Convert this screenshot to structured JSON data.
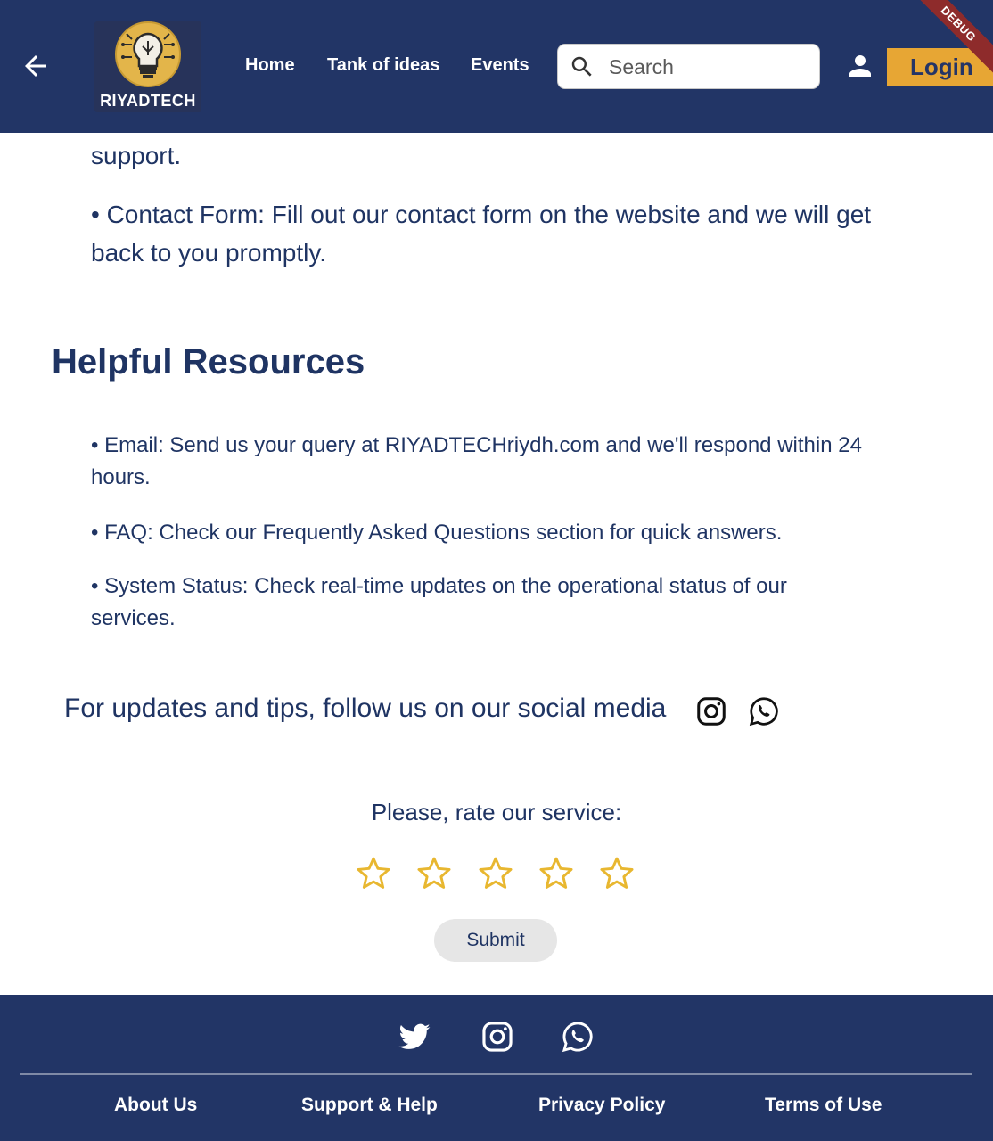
{
  "header": {
    "logo_text": "RIYADTECH",
    "nav": [
      {
        "label": "Home"
      },
      {
        "label": "Tank of ideas"
      },
      {
        "label": "Events"
      }
    ],
    "search_placeholder": "Search",
    "login_label": "Login",
    "debug_label": "DEBUG"
  },
  "content": {
    "support_tail": "support.",
    "contact_form": "• Contact Form: Fill out our contact form on the website and we will get back to you promptly.",
    "section_title": "Helpful Resources",
    "resources": [
      {
        "text": "• Email: Send us your query at RIYADTECHriydh.com and we'll respond within 24 hours."
      },
      {
        "text": "• FAQ: Check our Frequently Asked Questions section for quick answers."
      },
      {
        "text": "• System Status: Check real-time updates on the operational status of our services."
      }
    ],
    "social_text": "For updates and tips, follow us on our social media",
    "social_icons": [
      "instagram-icon",
      "whatsapp-icon"
    ]
  },
  "rating": {
    "label": "Please, rate our service:",
    "max_stars": 5,
    "selected": 0,
    "submit_label": "Submit"
  },
  "footer": {
    "icons": [
      "twitter-icon",
      "instagram-icon",
      "whatsapp-icon"
    ],
    "links": [
      {
        "label": "About Us"
      },
      {
        "label": "Support & Help"
      },
      {
        "label": "Privacy Policy"
      },
      {
        "label": "Terms of Use"
      }
    ]
  },
  "colors": {
    "primary": "#223566",
    "text": "#1f3463",
    "accent": "#e7a634",
    "star": "#e8b730"
  }
}
